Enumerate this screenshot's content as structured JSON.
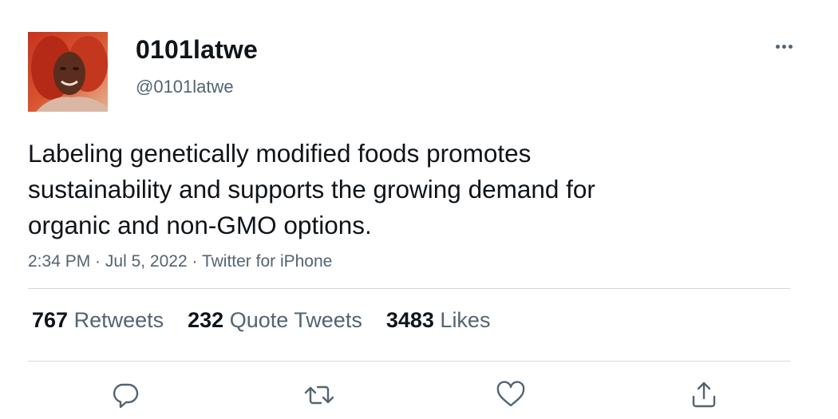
{
  "user": {
    "display_name": "0101latwe",
    "handle": "@0101latwe"
  },
  "tweet": {
    "text": "Labeling genetically modified foods promotes\nsustainability and supports the growing demand for\norganic and non-GMO options.",
    "time": "2:34 PM",
    "separator": " · ",
    "date": "Jul 5, 2022",
    "source": "Twitter for iPhone"
  },
  "stats": {
    "retweets_count": "767",
    "retweets_label": "Retweets",
    "quotes_count": "232",
    "quotes_label": "Quote Tweets",
    "likes_count": "3483",
    "likes_label": "Likes"
  },
  "icons": {
    "more": "more-icon",
    "reply": "reply-icon",
    "retweet": "retweet-icon",
    "like": "heart-icon",
    "share": "share-icon"
  },
  "colors": {
    "text_primary": "#0f1419",
    "text_secondary": "#536471",
    "divider": "#cfd9de"
  }
}
